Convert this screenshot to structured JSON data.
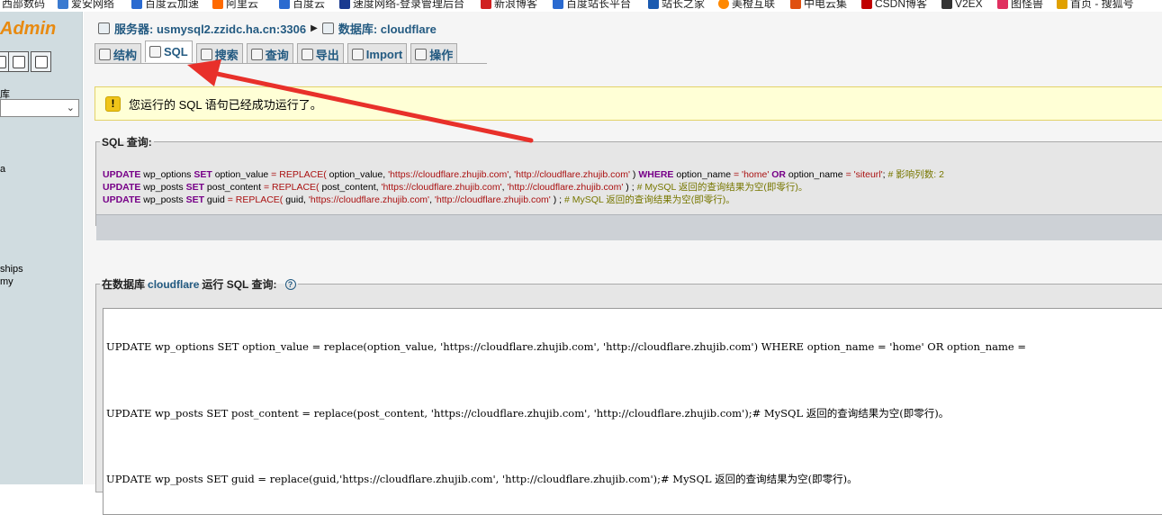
{
  "bookmarks": [
    {
      "label": "西部数码",
      "color": "#d03030"
    },
    {
      "label": "爱安网络",
      "color": "#3a7ad0"
    },
    {
      "label": "百度云加速",
      "color": "#2a6ad0"
    },
    {
      "label": "阿里云",
      "color": "#ff6a00"
    },
    {
      "label": "百度云",
      "color": "#2a6ad0"
    },
    {
      "label": "速度网络-登录管理后台",
      "color": "#1a3a90"
    },
    {
      "label": "新浪博客",
      "color": "#d02020"
    },
    {
      "label": "百度站长平台",
      "color": "#2a6ad0"
    },
    {
      "label": "站长之家",
      "color": "#1a5ab0"
    },
    {
      "label": "美橙互联",
      "color": "#ff8800"
    },
    {
      "label": "中电云集",
      "color": "#e05010"
    },
    {
      "label": "CSDN博客",
      "color": "#c00000"
    },
    {
      "label": "V2EX",
      "color": "#333333"
    },
    {
      "label": "图怪兽",
      "color": "#e03060"
    },
    {
      "label": "首页 - 搜狐号",
      "color": "#e0a000"
    }
  ],
  "sidebar": {
    "logo": "Admin",
    "db_label": "库",
    "items": [
      "a",
      "ships",
      "my"
    ]
  },
  "header": {
    "server_label": "服务器: usmysql2.zzidc.ha.cn:3306",
    "database_label": "数据库: cloudflare"
  },
  "tabs": [
    {
      "label": "结构",
      "active": false
    },
    {
      "label": "SQL",
      "active": true
    },
    {
      "label": "搜索",
      "active": false
    },
    {
      "label": "查询",
      "active": false
    },
    {
      "label": "导出",
      "active": false
    },
    {
      "label": "Import",
      "active": false
    },
    {
      "label": "操作",
      "active": false
    }
  ],
  "success": {
    "message": "您运行的 SQL 语句已经成功运行了。"
  },
  "sql_result": {
    "legend": "SQL 查询:",
    "line1": {
      "kw1": "UPDATE",
      "t1": " wp_options ",
      "kw2": "SET",
      "t2": " option_value ",
      "eq": "=",
      "fn": " REPLACE(",
      "t3": " option_value, ",
      "s1": "'https://cloudflare.zhujib.com'",
      "c1": ", ",
      "s2": "'http://cloudflare.zhujib.com'",
      "t4": " ) ",
      "kw3": "WHERE",
      "t5": " option_name ",
      "eq2": "=",
      "s3": " 'home' ",
      "kw4": "OR",
      "t6": " option_name ",
      "eq3": "=",
      "s4": " 'siteurl'",
      "t7": "; ",
      "comment": "# 影响列数: 2"
    },
    "line2": {
      "kw1": "UPDATE",
      "t1": " wp_posts ",
      "kw2": "SET",
      "t2": " post_content ",
      "eq": "=",
      "fn": " REPLACE(",
      "t3": " post_content, ",
      "s1": "'https://cloudflare.zhujib.com'",
      "c1": ", ",
      "s2": "'http://cloudflare.zhujib.com'",
      "t4": " ) ; ",
      "comment": "# MySQL 返回的查询结果为空(即零行)。"
    },
    "line3": {
      "kw1": "UPDATE",
      "t1": " wp_posts ",
      "kw2": "SET",
      "t2": " guid ",
      "eq": "=",
      "fn": " REPLACE(",
      "t3": " guid, ",
      "s1": "'https://cloudflare.zhujib.com'",
      "c1": ", ",
      "s2": "'http://cloudflare.zhujib.com'",
      "t4": " ) ; ",
      "comment": "# MySQL 返回的查询结果为空(即零行)。"
    }
  },
  "run_query": {
    "legend_prefix": "在数据库",
    "db": "cloudflare",
    "legend_suffix": "运行 SQL 查询:",
    "help": "?",
    "lines": [
      "UPDATE wp_options SET option_value = replace(option_value, 'https://cloudflare.zhujib.com', 'http://cloudflare.zhujib.com') WHERE option_name = 'home' OR option_name = ",
      "UPDATE wp_posts SET post_content = replace(post_content, 'https://cloudflare.zhujib.com', 'http://cloudflare.zhujib.com');# MySQL 返回的查询结果为空(即零行)。",
      "UPDATE wp_posts SET guid = replace(guid,'https://cloudflare.zhujib.com', 'http://cloudflare.zhujib.com');# MySQL 返回的查询结果为空(即零行)。"
    ]
  },
  "annotation": {
    "arrow_color": "#e8302a"
  }
}
